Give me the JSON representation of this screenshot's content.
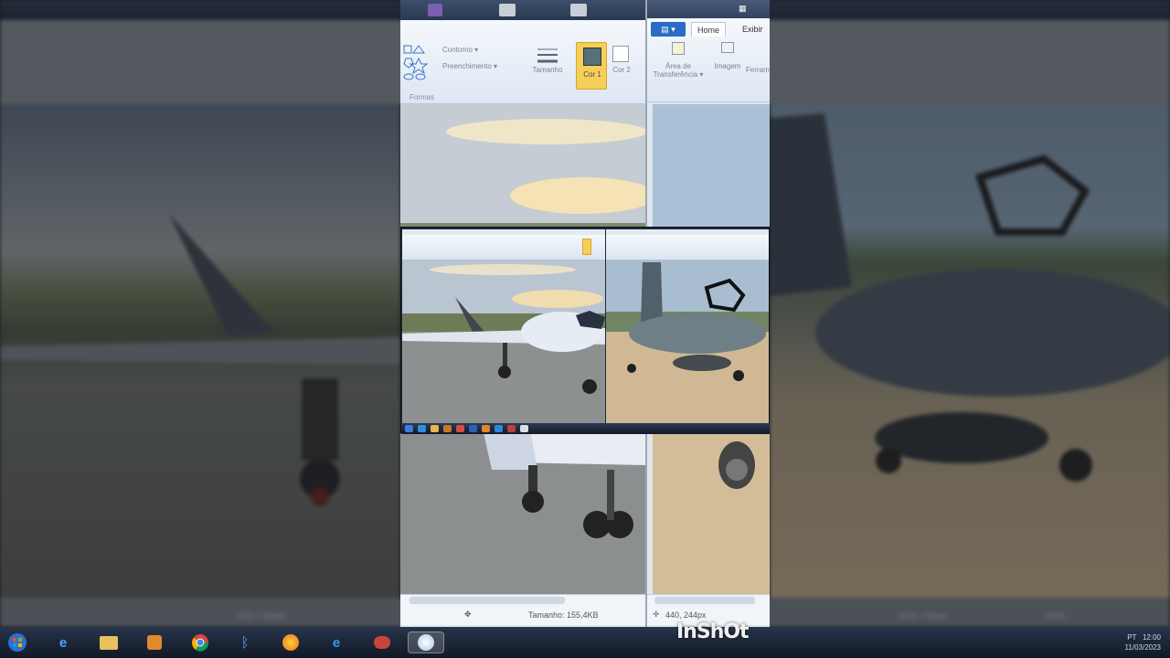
{
  "left_paint": {
    "file_button": "▤ ▾",
    "tabs": [
      {
        "label": "Home"
      },
      {
        "label": "Exibir"
      }
    ],
    "ribbon": {
      "contorno": "Contorno ▾",
      "preenchimento": "Preenchimento ▾",
      "formas_group": "Formas",
      "tamanho": "Tamanho",
      "cor1": "Cor 1",
      "cor2": "Cor 2"
    },
    "status": {
      "size": "Tamanho: 155,4KB"
    }
  },
  "right_paint": {
    "file_button": "▤ ▾",
    "tabs": [
      {
        "label": "Home"
      },
      {
        "label": "Exibir"
      }
    ],
    "ribbon": {
      "area_transferencia": "Área de Transferência ▾",
      "imagem": "Imagem",
      "ferramentas": "Ferramentas"
    },
    "status": {
      "coords": "440, 244px"
    }
  },
  "background": {
    "left_status": "1023 × 584px",
    "right_status": "1024 × 584px",
    "zoom": "100%"
  },
  "taskbar": {
    "icons": [
      "windows-start-icon",
      "ie-icon",
      "folder-icon",
      "media-icon",
      "chrome-icon",
      "bluetooth-icon",
      "firefox-icon",
      "edge-icon",
      "app-icon",
      "paint-icon"
    ],
    "tray_time": "12:00",
    "tray_date": "11/03/2023",
    "tray_lang": "PT"
  },
  "watermark": "InShOt",
  "colors": {
    "accent": "#2b6cc4",
    "cor1_selected": "#f6cf5a"
  }
}
